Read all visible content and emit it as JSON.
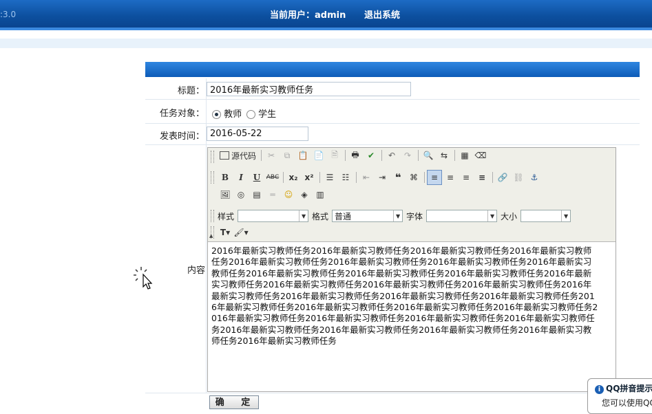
{
  "header": {
    "version_fragment": ":3.0",
    "current_user": "当前用户：admin",
    "logout": "退出系统"
  },
  "form": {
    "title_label": "标题：",
    "title_value": "2016年最新实习教师任务",
    "target_label": "任务对象：",
    "target_options": [
      "教师",
      "学生"
    ],
    "target_selected": "教师",
    "date_label": "发表时间：",
    "date_value": "2016-05-22",
    "content_label": "内容",
    "submit": "确 定"
  },
  "editor": {
    "source_label": "源代码",
    "style_label": "样式",
    "style_value": "",
    "format_label": "格式",
    "format_value": "普通",
    "font_label": "字体",
    "font_value": "",
    "size_label": "大小",
    "size_value": "",
    "content": "2016年最新实习教师任务2016年最新实习教师任务2016年最新实习教师任务2016年最新实习教师任务2016年最新实习教师任务2016年最新实习教师任务2016年最新实习教师任务2016年最新实习教师任务2016年最新实习教师任务2016年最新实习教师任务2016年最新实习教师任务2016年最新实习教师任务2016年最新实习教师任务2016年最新实习教师任务2016年最新实习教师任务2016年最新实习教师任务2016年最新实习教师任务2016年最新实习教师任务2016年最新实习教师任务2016年最新实习教师任务2016年最新实习教师任务2016年最新实习教师任务2016年最新实习教师任务2016年最新实习教师任务2016年最新实习教师任务2016年最新实习教师任务2016年最新实习教师任务2016年最新实习教师任务2016年最新实习教师任务2016年最新实习教师任务2016年最新实习教师任务2016年最新实习教师任务"
  },
  "qq_tip": {
    "title": "QQ拼音提示",
    "body": "您可以使用QQ"
  }
}
